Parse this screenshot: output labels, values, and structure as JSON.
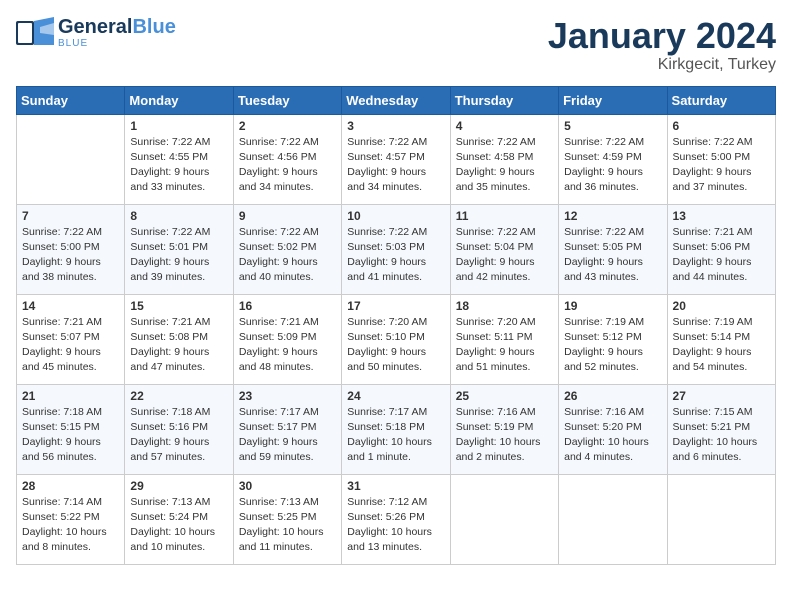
{
  "header": {
    "logo_general": "General",
    "logo_blue": "Blue",
    "month": "January 2024",
    "location": "Kirkgecit, Turkey"
  },
  "weekdays": [
    "Sunday",
    "Monday",
    "Tuesday",
    "Wednesday",
    "Thursday",
    "Friday",
    "Saturday"
  ],
  "weeks": [
    [
      {
        "day": "",
        "info": ""
      },
      {
        "day": "1",
        "info": "Sunrise: 7:22 AM\nSunset: 4:55 PM\nDaylight: 9 hours\nand 33 minutes."
      },
      {
        "day": "2",
        "info": "Sunrise: 7:22 AM\nSunset: 4:56 PM\nDaylight: 9 hours\nand 34 minutes."
      },
      {
        "day": "3",
        "info": "Sunrise: 7:22 AM\nSunset: 4:57 PM\nDaylight: 9 hours\nand 34 minutes."
      },
      {
        "day": "4",
        "info": "Sunrise: 7:22 AM\nSunset: 4:58 PM\nDaylight: 9 hours\nand 35 minutes."
      },
      {
        "day": "5",
        "info": "Sunrise: 7:22 AM\nSunset: 4:59 PM\nDaylight: 9 hours\nand 36 minutes."
      },
      {
        "day": "6",
        "info": "Sunrise: 7:22 AM\nSunset: 5:00 PM\nDaylight: 9 hours\nand 37 minutes."
      }
    ],
    [
      {
        "day": "7",
        "info": "Sunrise: 7:22 AM\nSunset: 5:00 PM\nDaylight: 9 hours\nand 38 minutes."
      },
      {
        "day": "8",
        "info": "Sunrise: 7:22 AM\nSunset: 5:01 PM\nDaylight: 9 hours\nand 39 minutes."
      },
      {
        "day": "9",
        "info": "Sunrise: 7:22 AM\nSunset: 5:02 PM\nDaylight: 9 hours\nand 40 minutes."
      },
      {
        "day": "10",
        "info": "Sunrise: 7:22 AM\nSunset: 5:03 PM\nDaylight: 9 hours\nand 41 minutes."
      },
      {
        "day": "11",
        "info": "Sunrise: 7:22 AM\nSunset: 5:04 PM\nDaylight: 9 hours\nand 42 minutes."
      },
      {
        "day": "12",
        "info": "Sunrise: 7:22 AM\nSunset: 5:05 PM\nDaylight: 9 hours\nand 43 minutes."
      },
      {
        "day": "13",
        "info": "Sunrise: 7:21 AM\nSunset: 5:06 PM\nDaylight: 9 hours\nand 44 minutes."
      }
    ],
    [
      {
        "day": "14",
        "info": "Sunrise: 7:21 AM\nSunset: 5:07 PM\nDaylight: 9 hours\nand 45 minutes."
      },
      {
        "day": "15",
        "info": "Sunrise: 7:21 AM\nSunset: 5:08 PM\nDaylight: 9 hours\nand 47 minutes."
      },
      {
        "day": "16",
        "info": "Sunrise: 7:21 AM\nSunset: 5:09 PM\nDaylight: 9 hours\nand 48 minutes."
      },
      {
        "day": "17",
        "info": "Sunrise: 7:20 AM\nSunset: 5:10 PM\nDaylight: 9 hours\nand 50 minutes."
      },
      {
        "day": "18",
        "info": "Sunrise: 7:20 AM\nSunset: 5:11 PM\nDaylight: 9 hours\nand 51 minutes."
      },
      {
        "day": "19",
        "info": "Sunrise: 7:19 AM\nSunset: 5:12 PM\nDaylight: 9 hours\nand 52 minutes."
      },
      {
        "day": "20",
        "info": "Sunrise: 7:19 AM\nSunset: 5:14 PM\nDaylight: 9 hours\nand 54 minutes."
      }
    ],
    [
      {
        "day": "21",
        "info": "Sunrise: 7:18 AM\nSunset: 5:15 PM\nDaylight: 9 hours\nand 56 minutes."
      },
      {
        "day": "22",
        "info": "Sunrise: 7:18 AM\nSunset: 5:16 PM\nDaylight: 9 hours\nand 57 minutes."
      },
      {
        "day": "23",
        "info": "Sunrise: 7:17 AM\nSunset: 5:17 PM\nDaylight: 9 hours\nand 59 minutes."
      },
      {
        "day": "24",
        "info": "Sunrise: 7:17 AM\nSunset: 5:18 PM\nDaylight: 10 hours\nand 1 minute."
      },
      {
        "day": "25",
        "info": "Sunrise: 7:16 AM\nSunset: 5:19 PM\nDaylight: 10 hours\nand 2 minutes."
      },
      {
        "day": "26",
        "info": "Sunrise: 7:16 AM\nSunset: 5:20 PM\nDaylight: 10 hours\nand 4 minutes."
      },
      {
        "day": "27",
        "info": "Sunrise: 7:15 AM\nSunset: 5:21 PM\nDaylight: 10 hours\nand 6 minutes."
      }
    ],
    [
      {
        "day": "28",
        "info": "Sunrise: 7:14 AM\nSunset: 5:22 PM\nDaylight: 10 hours\nand 8 minutes."
      },
      {
        "day": "29",
        "info": "Sunrise: 7:13 AM\nSunset: 5:24 PM\nDaylight: 10 hours\nand 10 minutes."
      },
      {
        "day": "30",
        "info": "Sunrise: 7:13 AM\nSunset: 5:25 PM\nDaylight: 10 hours\nand 11 minutes."
      },
      {
        "day": "31",
        "info": "Sunrise: 7:12 AM\nSunset: 5:26 PM\nDaylight: 10 hours\nand 13 minutes."
      },
      {
        "day": "",
        "info": ""
      },
      {
        "day": "",
        "info": ""
      },
      {
        "day": "",
        "info": ""
      }
    ]
  ]
}
